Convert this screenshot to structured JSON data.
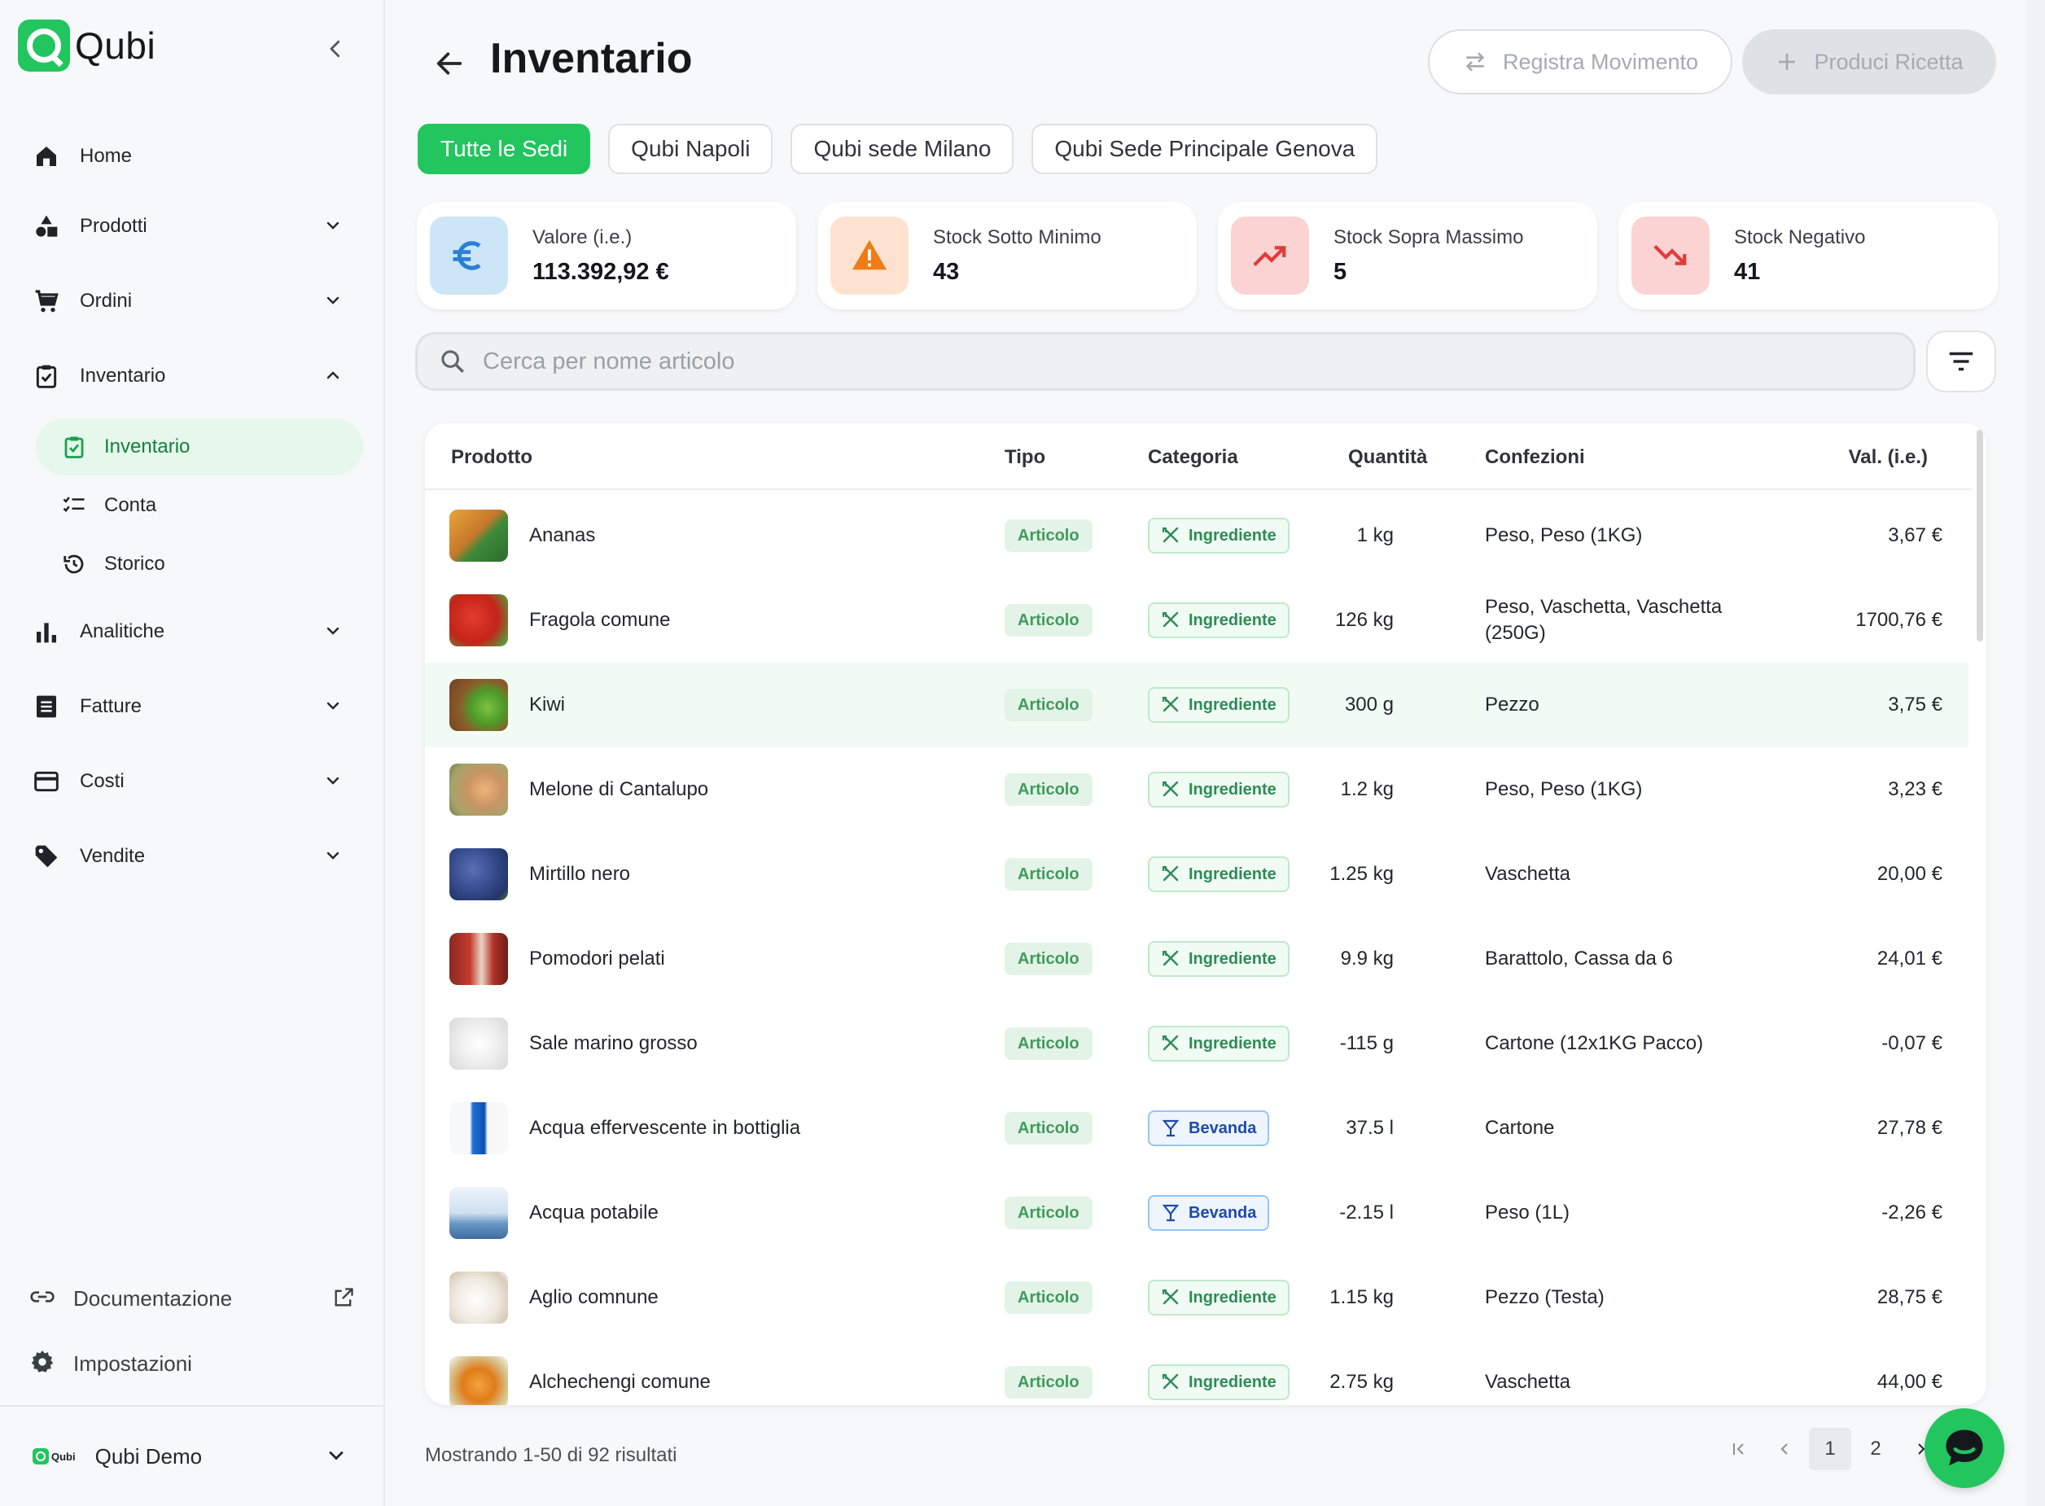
{
  "brand": {
    "name": "Qubi"
  },
  "sidebar": {
    "items": [
      {
        "label": "Home",
        "icon": "home-icon"
      },
      {
        "label": "Prodotti",
        "icon": "shapes-icon"
      },
      {
        "label": "Ordini",
        "icon": "cart-icon"
      },
      {
        "label": "Inventario",
        "icon": "clipboard-check-icon"
      },
      {
        "label": "Analitiche",
        "icon": "bar-chart-icon"
      },
      {
        "label": "Fatture",
        "icon": "receipt-icon"
      },
      {
        "label": "Costi",
        "icon": "credit-card-icon"
      },
      {
        "label": "Vendite",
        "icon": "tag-icon"
      }
    ],
    "subitems": [
      {
        "label": "Inventario",
        "icon": "clipboard-check-icon",
        "active": true
      },
      {
        "label": "Conta",
        "icon": "checklist-icon"
      },
      {
        "label": "Storico",
        "icon": "history-icon"
      }
    ],
    "footer": {
      "docs_label": "Documentazione",
      "settings_label": "Impostazioni",
      "account_label": "Qubi Demo",
      "mini_logo_text": "Qubi"
    }
  },
  "header": {
    "title": "Inventario",
    "register_label": "Registra Movimento",
    "produce_label": "Produci Ricetta"
  },
  "tabs": [
    {
      "label": "Tutte le Sedi",
      "active": true
    },
    {
      "label": "Qubi Napoli"
    },
    {
      "label": "Qubi sede Milano"
    },
    {
      "label": "Qubi Sede Principale Genova"
    }
  ],
  "stats": [
    {
      "label": "Valore (i.e.)",
      "value": "113.392,92 €"
    },
    {
      "label": "Stock Sotto Minimo",
      "value": "43"
    },
    {
      "label": "Stock Sopra Massimo",
      "value": "5"
    },
    {
      "label": "Stock Negativo",
      "value": "41"
    }
  ],
  "search": {
    "placeholder": "Cerca per nome articolo"
  },
  "table": {
    "headers": [
      "Prodotto",
      "Tipo",
      "Categoria",
      "Quantità",
      "Confezioni",
      "Val. (i.e.)"
    ],
    "rows": [
      {
        "name": "Ananas",
        "tipo": "Articolo",
        "categoria": "Ingrediente",
        "qty": "1 kg",
        "conf": "Peso, Peso (1KG)",
        "val": "3,67 €"
      },
      {
        "name": "Fragola comune",
        "tipo": "Articolo",
        "categoria": "Ingrediente",
        "qty": "126 kg",
        "conf": "Peso, Vaschetta, Vaschetta",
        "conf2": "(250G)",
        "val": "1700,76 €"
      },
      {
        "name": "Kiwi",
        "tipo": "Articolo",
        "categoria": "Ingrediente",
        "qty": "300 g",
        "conf": "Pezzo",
        "val": "3,75 €"
      },
      {
        "name": "Melone di Cantalupo",
        "tipo": "Articolo",
        "categoria": "Ingrediente",
        "qty": "1.2 kg",
        "conf": "Peso, Peso (1KG)",
        "val": "3,23 €"
      },
      {
        "name": "Mirtillo nero",
        "tipo": "Articolo",
        "categoria": "Ingrediente",
        "qty": "1.25 kg",
        "conf": "Vaschetta",
        "val": "20,00 €"
      },
      {
        "name": "Pomodori pelati",
        "tipo": "Articolo",
        "categoria": "Ingrediente",
        "qty": "9.9 kg",
        "conf": "Barattolo, Cassa da 6",
        "val": "24,01 €"
      },
      {
        "name": "Sale marino grosso",
        "tipo": "Articolo",
        "categoria": "Ingrediente",
        "qty": "-115 g",
        "conf": "Cartone (12x1KG Pacco)",
        "val": "-0,07 €"
      },
      {
        "name": "Acqua effervescente in bottiglia",
        "tipo": "Articolo",
        "categoria": "Bevanda",
        "qty": "37.5 l",
        "conf": "Cartone",
        "val": "27,78 €"
      },
      {
        "name": "Acqua potabile",
        "tipo": "Articolo",
        "categoria": "Bevanda",
        "qty": "-2.15 l",
        "conf": "Peso (1L)",
        "val": "-2,26 €"
      },
      {
        "name": "Aglio comnune",
        "tipo": "Articolo",
        "categoria": "Ingrediente",
        "qty": "1.15 kg",
        "conf": "Pezzo (Testa)",
        "val": "28,75 €"
      },
      {
        "name": "Alchechengi comune",
        "tipo": "Articolo",
        "categoria": "Ingrediente",
        "qty": "2.75 kg",
        "conf": "Vaschetta",
        "val": "44,00 €"
      }
    ]
  },
  "pagination": {
    "results_text": "Mostrando 1-50 di 92 risultati",
    "page1": "1",
    "page2": "2"
  },
  "colors": {
    "accent": "#22c55e",
    "accent_dark": "#15803d",
    "bevanda": "#1e4aa8"
  }
}
